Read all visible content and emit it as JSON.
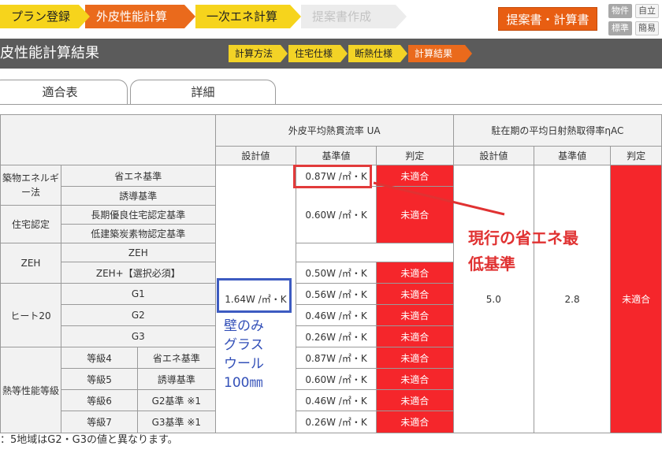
{
  "steps": {
    "plan": "プラン登録",
    "envelope": "外皮性能計算",
    "primary_energy": "一次エネ計算",
    "proposal": "提案書作成"
  },
  "header": {
    "proposal_button": "提案書・計算書",
    "mini": [
      "物件",
      "自立",
      "標準",
      "簡易"
    ]
  },
  "title_band": {
    "page_title": "皮性能計算結果",
    "substeps": [
      "計算方法",
      "住宅仕様",
      "断熱仕様",
      "計算結果"
    ]
  },
  "tabs": [
    "適合表",
    "詳細"
  ],
  "table": {
    "group_ua": "外皮平均熱貫流率 UA",
    "group_eta": "駐在期の平均日射熱取得率ηAC",
    "col_design": "設計値",
    "col_standard": "基準値",
    "col_judge": "判定",
    "categories": {
      "building_energy_law": "築物エネルギー法",
      "housing_cert": "住宅認定",
      "zeh": "ZEH",
      "heat20": "ヒート20",
      "insulation_grade": "熱等性能等級"
    },
    "rows": {
      "energy_saving_std": "省エネ基準",
      "induction_std": "誘導基準",
      "long_life": "長期優良住宅認定基準",
      "low_carbon": "低建築炭素物認定基準",
      "zeh": "ZEH",
      "zeh_plus": "ZEH+【選択必須】",
      "g1": "G1",
      "g2": "G2",
      "g3": "G3",
      "grade4": "等級4",
      "grade5": "等級5",
      "grade6": "等級6",
      "grade7": "等級7",
      "grade4_sub": "省エネ基準",
      "grade5_sub": "誘導基準",
      "grade6_sub": "G2基準 ※1",
      "grade7_sub": "G3基準 ※1"
    },
    "ua_design": "1.64W /㎡・K",
    "ua_standards": [
      "0.87W /㎡・K",
      "0.60W /㎡・K",
      "0.50W /㎡・K",
      "0.56W /㎡・K",
      "0.46W /㎡・K",
      "0.26W /㎡・K",
      "0.87W /㎡・K",
      "0.60W /㎡・K",
      "0.46W /㎡・K",
      "0.26W /㎡・K"
    ],
    "judge_fail": "未適合",
    "eta_design": "5.0",
    "eta_standard": "2.8",
    "eta_judge": "未適合"
  },
  "footnote": "：5地域はG2・G3の値と異なります。",
  "annotations": {
    "red_text": "現行の省エネ最\n低基準",
    "blue_text": "壁のみ\nグラス\nウール\n100㎜"
  },
  "colors": {
    "step_yellow": "#f6d41c",
    "step_orange": "#ea6a1c",
    "fail_red": "#f5262b",
    "annot_red": "#e03232",
    "annot_blue": "#3350b8"
  }
}
